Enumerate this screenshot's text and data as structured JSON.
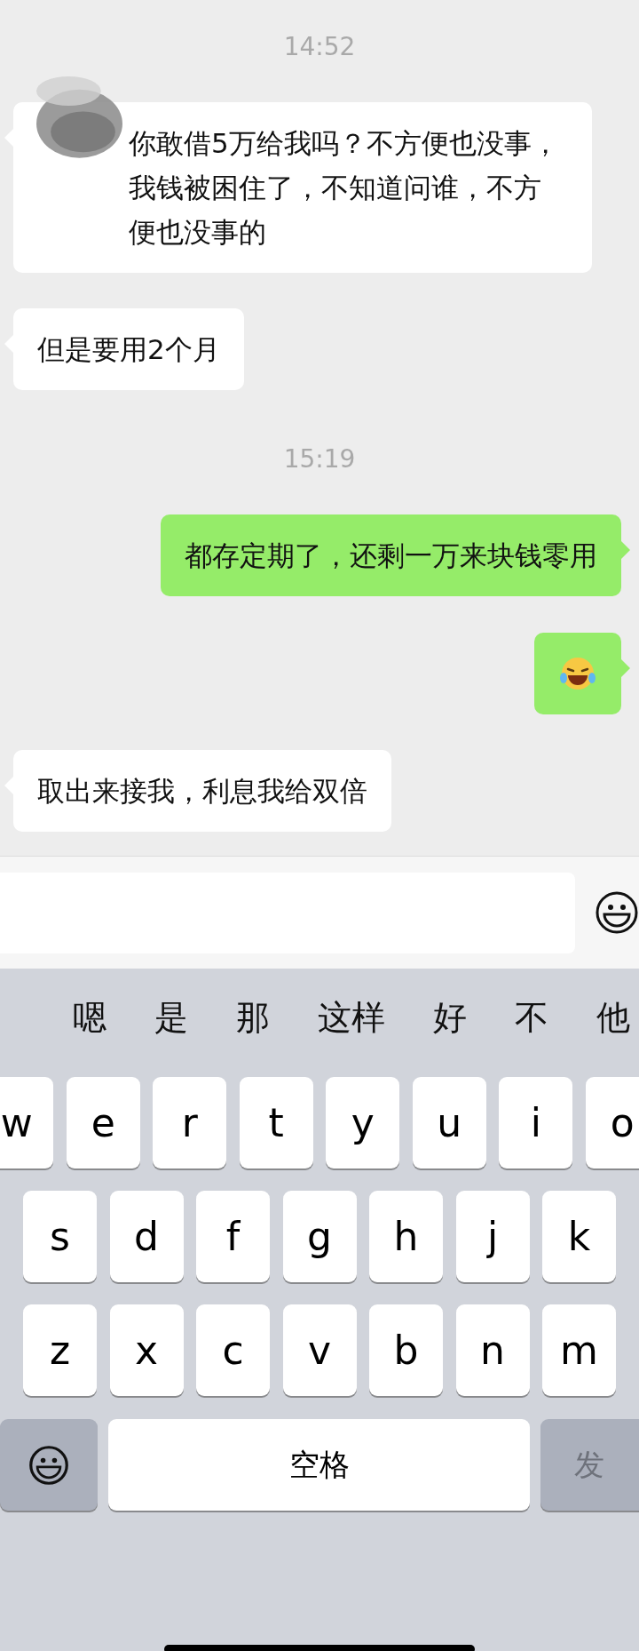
{
  "messages": [
    {
      "kind": "time",
      "text": "14:52"
    },
    {
      "kind": "received",
      "redacted": true,
      "text": "你敢借5万给我吗？不方便也没事，我钱被困住了，不知道问谁，不方便也没事的"
    },
    {
      "kind": "received",
      "redacted": false,
      "text": "但是要用2个月"
    },
    {
      "kind": "time",
      "text": "15:19"
    },
    {
      "kind": "sent",
      "redacted": false,
      "text": "都存定期了，还剩一万来块钱零用"
    },
    {
      "kind": "sent_emoji"
    },
    {
      "kind": "received",
      "redacted": false,
      "text": "取出来接我，利息我给双倍"
    }
  ],
  "keyboard": {
    "candidates": [
      "嗯",
      "是",
      "那",
      "这样",
      "好",
      "不",
      "他"
    ],
    "rows": [
      [
        "w",
        "e",
        "r",
        "t",
        "y",
        "u",
        "i",
        "o"
      ],
      [
        "s",
        "d",
        "f",
        "g",
        "h",
        "j",
        "k"
      ],
      [
        "z",
        "x",
        "c",
        "v",
        "b",
        "n",
        "m"
      ]
    ],
    "space_key": "空格",
    "send_key": "发"
  }
}
